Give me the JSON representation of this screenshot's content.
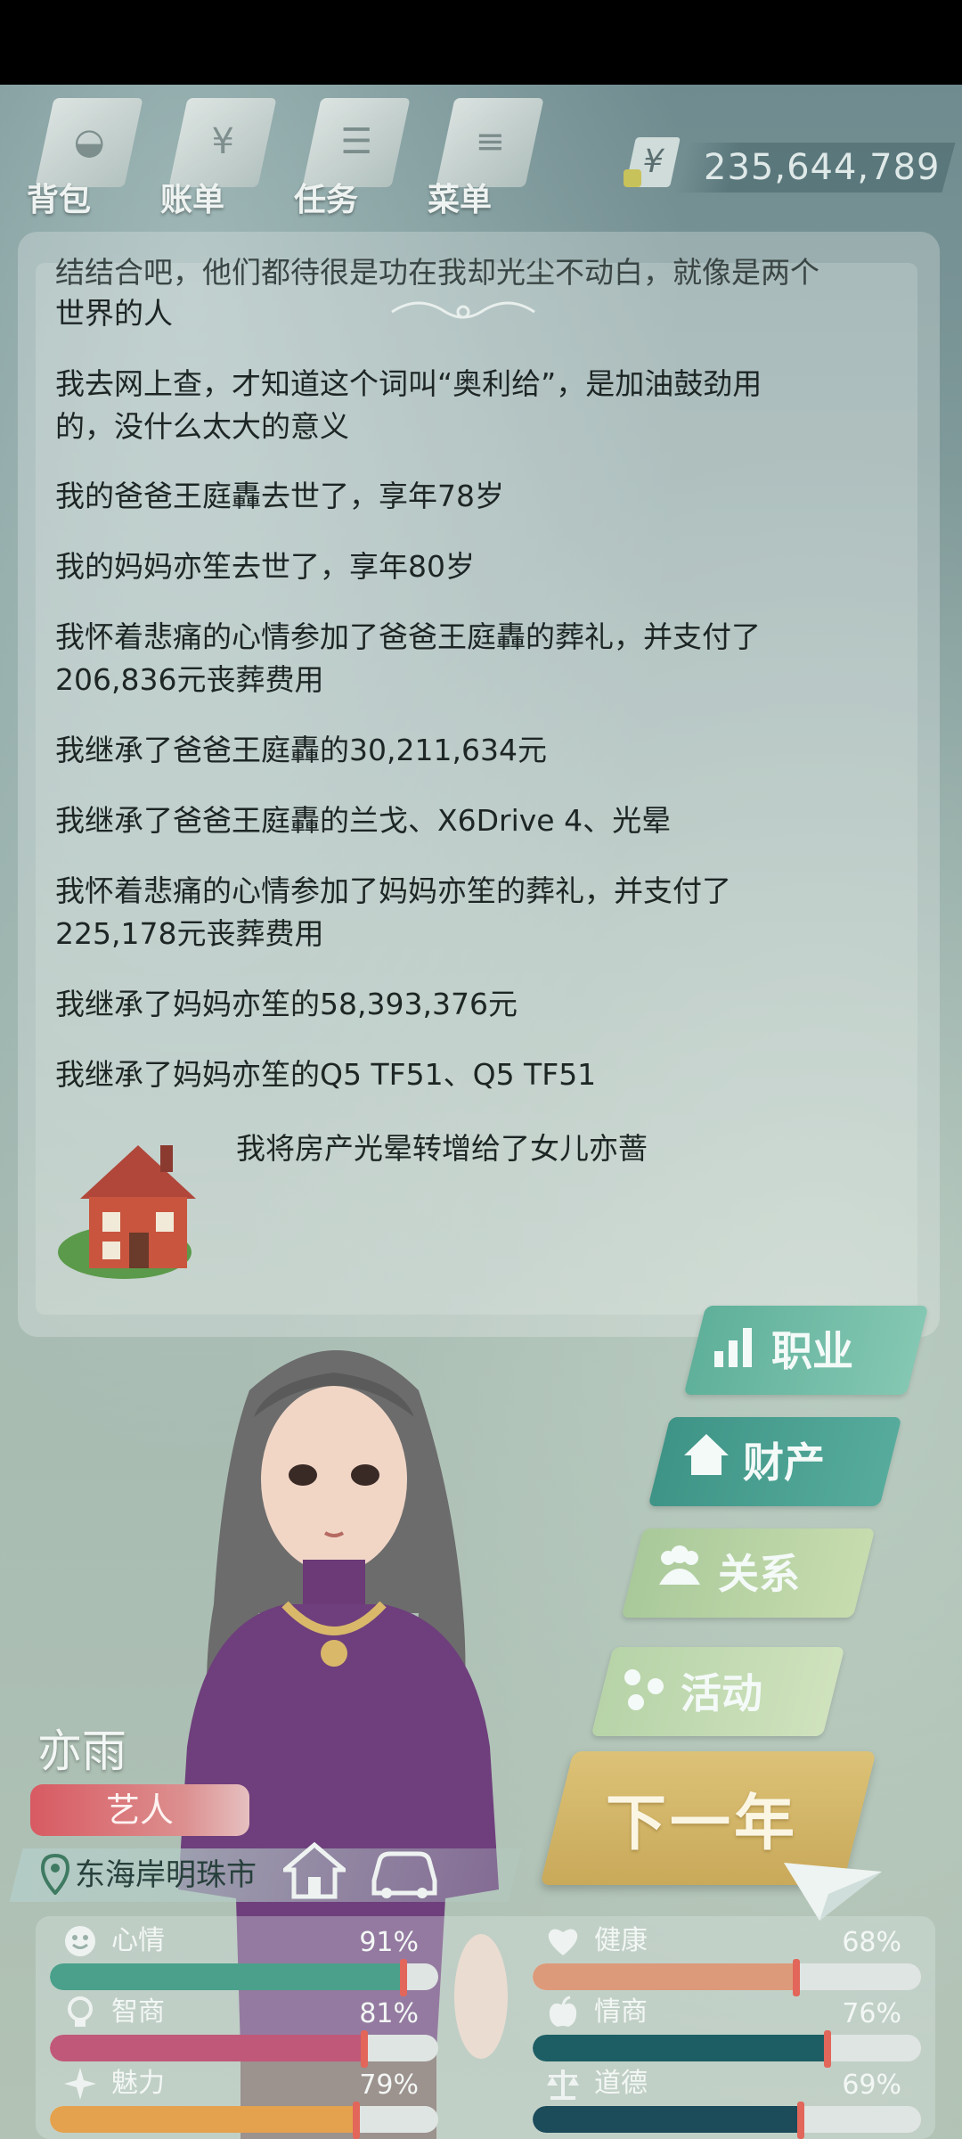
{
  "toolbar": {
    "items": [
      {
        "label": "背包",
        "icon": "backpack-icon"
      },
      {
        "label": "账单",
        "icon": "bill-icon"
      },
      {
        "label": "任务",
        "icon": "task-icon"
      },
      {
        "label": "菜单",
        "icon": "menu-icon"
      }
    ],
    "currency_symbol": "¥",
    "money": "235,644,789"
  },
  "log": {
    "entries": [
      "结结合吧，他们都待很是功在我却光尘不动白，就像是两个",
      "世界的人",
      "我去网上查，才知道这个词叫“奥利给”，是加油鼓劲用",
      "的，没什么太大的意义",
      "我的爸爸王庭轟去世了，享年78岁",
      "我的妈妈亦笙去世了，享年80岁",
      "我怀着悲痛的心情参加了爸爸王庭轟的葬礼，并支付了",
      "206,836元丧葬费用",
      "我继承了爸爸王庭轟的30,211,634元",
      "我继承了爸爸王庭轟的兰戈、X6Drive 4、光晕",
      "我怀着悲痛的心情参加了妈妈亦笙的葬礼，并支付了",
      "225,178元丧葬费用",
      "我继承了妈妈亦笙的58,393,376元",
      "我继承了妈妈亦笙的Q5 TF51、Q5 TF51"
    ],
    "house_entry": "我将房产光晕转增给了女儿亦蔷"
  },
  "menu": {
    "career": "职业",
    "property": "财产",
    "relations": "关系",
    "activity": "活动",
    "next_year": "下一年"
  },
  "character": {
    "name": "亦雨",
    "job": "艺人",
    "location": "东海岸明珠市"
  },
  "stats": [
    {
      "label": "心情",
      "value": "91%",
      "pct": 91,
      "icon": "smile-icon",
      "color": "#4aa08a"
    },
    {
      "label": "健康",
      "value": "68%",
      "pct": 68,
      "icon": "heart-icon",
      "color": "#dd9a7a"
    },
    {
      "label": "智商",
      "value": "81%",
      "pct": 81,
      "icon": "lightbulb-icon",
      "color": "#c0587a"
    },
    {
      "label": "情商",
      "value": "76%",
      "pct": 76,
      "icon": "apple-icon",
      "color": "#1d5e64"
    },
    {
      "label": "魅力",
      "value": "79%",
      "pct": 79,
      "icon": "sparkle-icon",
      "color": "#e4a24e"
    },
    {
      "label": "道德",
      "value": "69%",
      "pct": 69,
      "icon": "scales-icon",
      "color": "#1c4b5a"
    }
  ]
}
